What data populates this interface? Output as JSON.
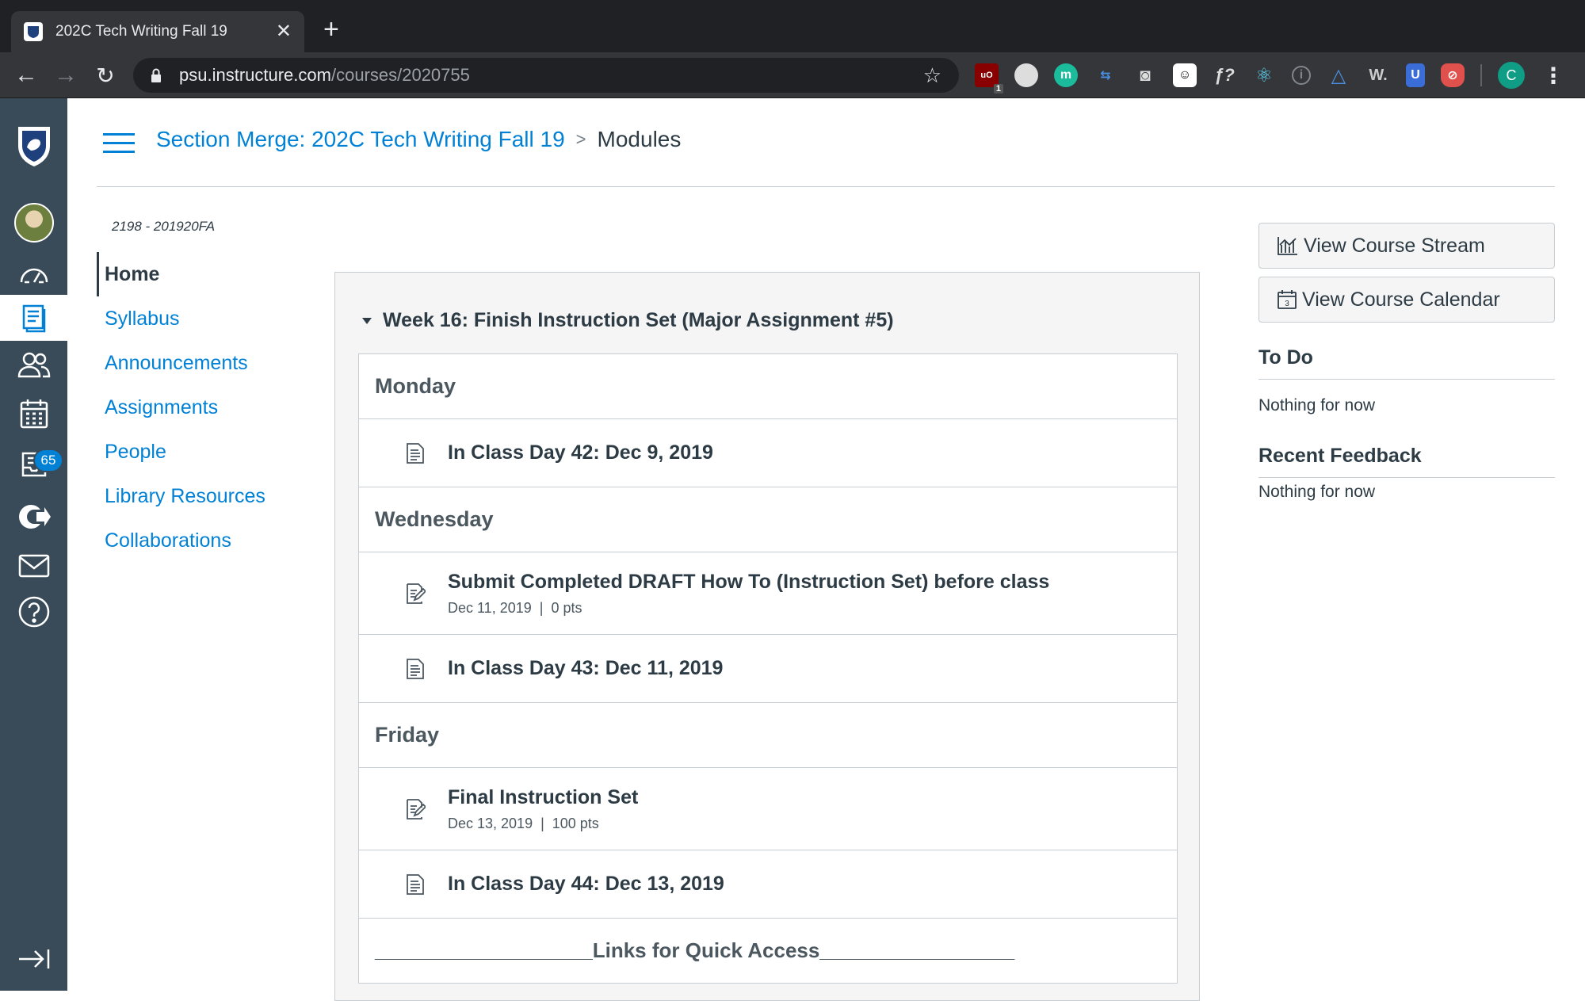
{
  "browser": {
    "tab_title": "202C Tech Writing Fall 19",
    "url_host": "psu.instructure.com",
    "url_path": "/courses/2020755",
    "profile_initial": "C",
    "ublock_count": "1"
  },
  "global_nav": {
    "inbox_badge": "65"
  },
  "header": {
    "course_link": "Section Merge: 202C Tech Writing Fall 19",
    "separator": ">",
    "current_page": "Modules"
  },
  "course_nav": {
    "course_code": "2198 - 201920FA",
    "items": [
      {
        "label": "Home"
      },
      {
        "label": "Syllabus"
      },
      {
        "label": "Announcements"
      },
      {
        "label": "Assignments"
      },
      {
        "label": "People"
      },
      {
        "label": "Library Resources"
      },
      {
        "label": "Collaborations"
      }
    ]
  },
  "module": {
    "title": "Week 16: Finish Instruction Set (Major Assignment #5)",
    "rows": [
      {
        "type": "subheader",
        "title": "Monday"
      },
      {
        "type": "page",
        "title": "In Class Day 42: Dec 9, 2019"
      },
      {
        "type": "subheader",
        "title": "Wednesday"
      },
      {
        "type": "assignment",
        "title": "Submit Completed DRAFT How To (Instruction Set) before class",
        "date": "Dec 11, 2019",
        "points": "0 pts"
      },
      {
        "type": "page",
        "title": "In Class Day 43: Dec 11, 2019"
      },
      {
        "type": "subheader",
        "title": "Friday"
      },
      {
        "type": "assignment",
        "title": "Final Instruction Set",
        "date": "Dec 13, 2019",
        "points": "100 pts"
      },
      {
        "type": "page",
        "title": "In Class Day 44: Dec 13, 2019"
      },
      {
        "type": "subheader",
        "title": "___________________Links for Quick Access_________________"
      }
    ]
  },
  "sidebar": {
    "stream_button": "View Course Stream",
    "calendar_button": "View Course Calendar",
    "todo_heading": "To Do",
    "todo_text": "Nothing for now",
    "feedback_heading": "Recent Feedback",
    "feedback_text": "Nothing for now"
  },
  "colors": {
    "link": "#0081d6",
    "nav_bg": "#394b58",
    "text": "#2d3b45"
  }
}
